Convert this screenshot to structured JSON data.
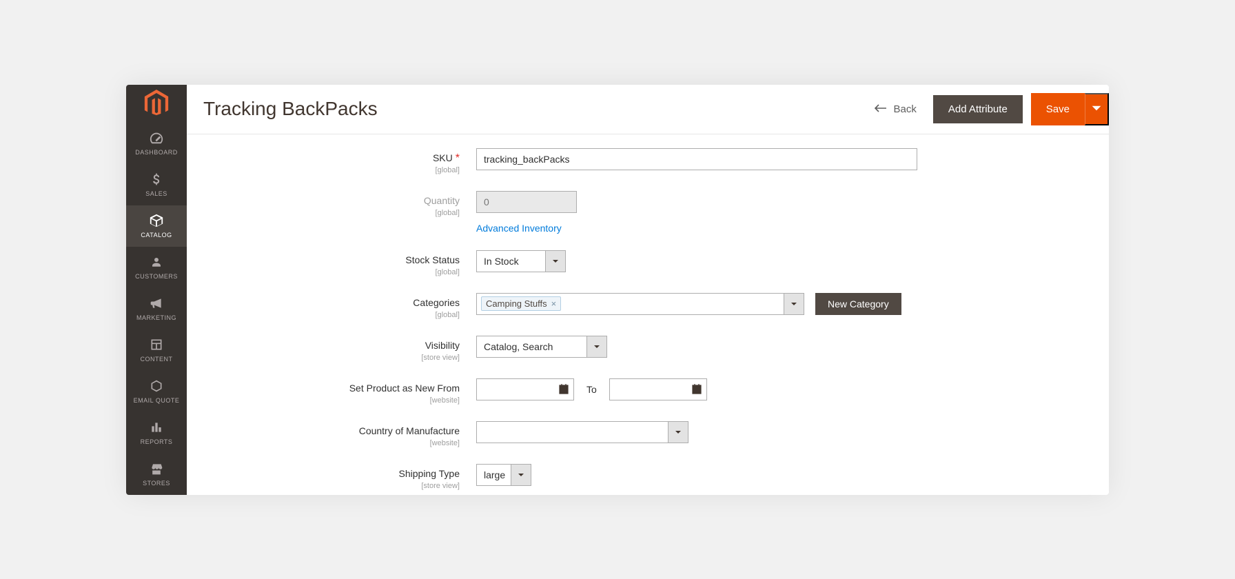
{
  "header": {
    "title": "Tracking BackPacks",
    "back": "Back",
    "add_attribute": "Add Attribute",
    "save": "Save"
  },
  "sidebar": {
    "items": [
      {
        "label": "DASHBOARD"
      },
      {
        "label": "SALES"
      },
      {
        "label": "CATALOG"
      },
      {
        "label": "CUSTOMERS"
      },
      {
        "label": "MARKETING"
      },
      {
        "label": "CONTENT"
      },
      {
        "label": "EMAIL QUOTE"
      },
      {
        "label": "REPORTS"
      },
      {
        "label": "STORES"
      }
    ]
  },
  "fields": {
    "sku": {
      "label": "SKU",
      "scope": "[global]",
      "value": "tracking_backPacks"
    },
    "quantity": {
      "label": "Quantity",
      "scope": "[global]",
      "placeholder": "0",
      "advanced": "Advanced Inventory"
    },
    "stock_status": {
      "label": "Stock Status",
      "scope": "[global]",
      "value": "In Stock"
    },
    "categories": {
      "label": "Categories",
      "scope": "[global]",
      "chip": "Camping Stuffs",
      "new_category": "New Category"
    },
    "visibility": {
      "label": "Visibility",
      "scope": "[store view]",
      "value": "Catalog, Search"
    },
    "new_from": {
      "label": "Set Product as New From",
      "scope": "[website]",
      "to": "To"
    },
    "country": {
      "label": "Country of Manufacture",
      "scope": "[website]",
      "value": ""
    },
    "shipping": {
      "label": "Shipping Type",
      "scope": "[store view]",
      "value": "large"
    }
  }
}
